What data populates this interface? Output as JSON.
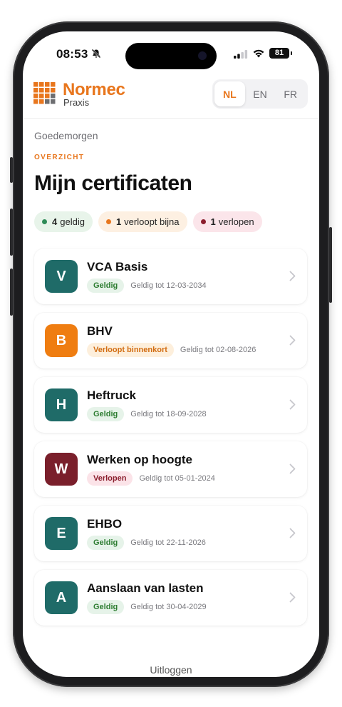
{
  "status_bar": {
    "time": "08:53",
    "battery": "81"
  },
  "header": {
    "brand": "Normec",
    "brand_sub": "Praxis",
    "languages": [
      "NL",
      "EN",
      "FR"
    ],
    "active_language": "NL"
  },
  "greeting": "Goedemorgen",
  "section_label": "OVERZICHT",
  "page_title": "Mijn certificaten",
  "summary": [
    {
      "count": "4",
      "label": "geldig",
      "dot": "#2e8b57",
      "bg": "#e8f4ea"
    },
    {
      "count": "1",
      "label": "verloopt bijna",
      "dot": "#e8761d",
      "bg": "#fdf0e2"
    },
    {
      "count": "1",
      "label": "verlopen",
      "dot": "#8b1e2d",
      "bg": "#fbe5ea"
    }
  ],
  "certificates": [
    {
      "letter": "V",
      "name": "VCA Basis",
      "status": "Geldig",
      "valid_until": "Geldig tot 12-03-2034",
      "color": "#1f6b68",
      "badge_bg": "#e6f3e9",
      "badge_fg": "#2e7d32"
    },
    {
      "letter": "B",
      "name": "BHV",
      "status": "Verloopt binnenkort",
      "valid_until": "Geldig tot 02-08-2026",
      "color": "#ef7d11",
      "badge_bg": "#fdefdc",
      "badge_fg": "#d26d12"
    },
    {
      "letter": "H",
      "name": "Heftruck",
      "status": "Geldig",
      "valid_until": "Geldig tot 18-09-2028",
      "color": "#1f6b68",
      "badge_bg": "#e6f3e9",
      "badge_fg": "#2e7d32"
    },
    {
      "letter": "W",
      "name": "Werken op hoogte",
      "status": "Verlopen",
      "valid_until": "Geldig tot 05-01-2024",
      "color": "#7a1f2b",
      "badge_bg": "#fbe3e8",
      "badge_fg": "#8b1e2d"
    },
    {
      "letter": "E",
      "name": "EHBO",
      "status": "Geldig",
      "valid_until": "Geldig tot 22-11-2026",
      "color": "#1f6b68",
      "badge_bg": "#e6f3e9",
      "badge_fg": "#2e7d32"
    },
    {
      "letter": "A",
      "name": "Aanslaan van lasten",
      "status": "Geldig",
      "valid_until": "Geldig tot 30-04-2029",
      "color": "#1f6b68",
      "badge_bg": "#e6f3e9",
      "badge_fg": "#2e7d32"
    }
  ],
  "logout_label": "Uitloggen",
  "colors": {
    "accent": "#e8761d"
  }
}
